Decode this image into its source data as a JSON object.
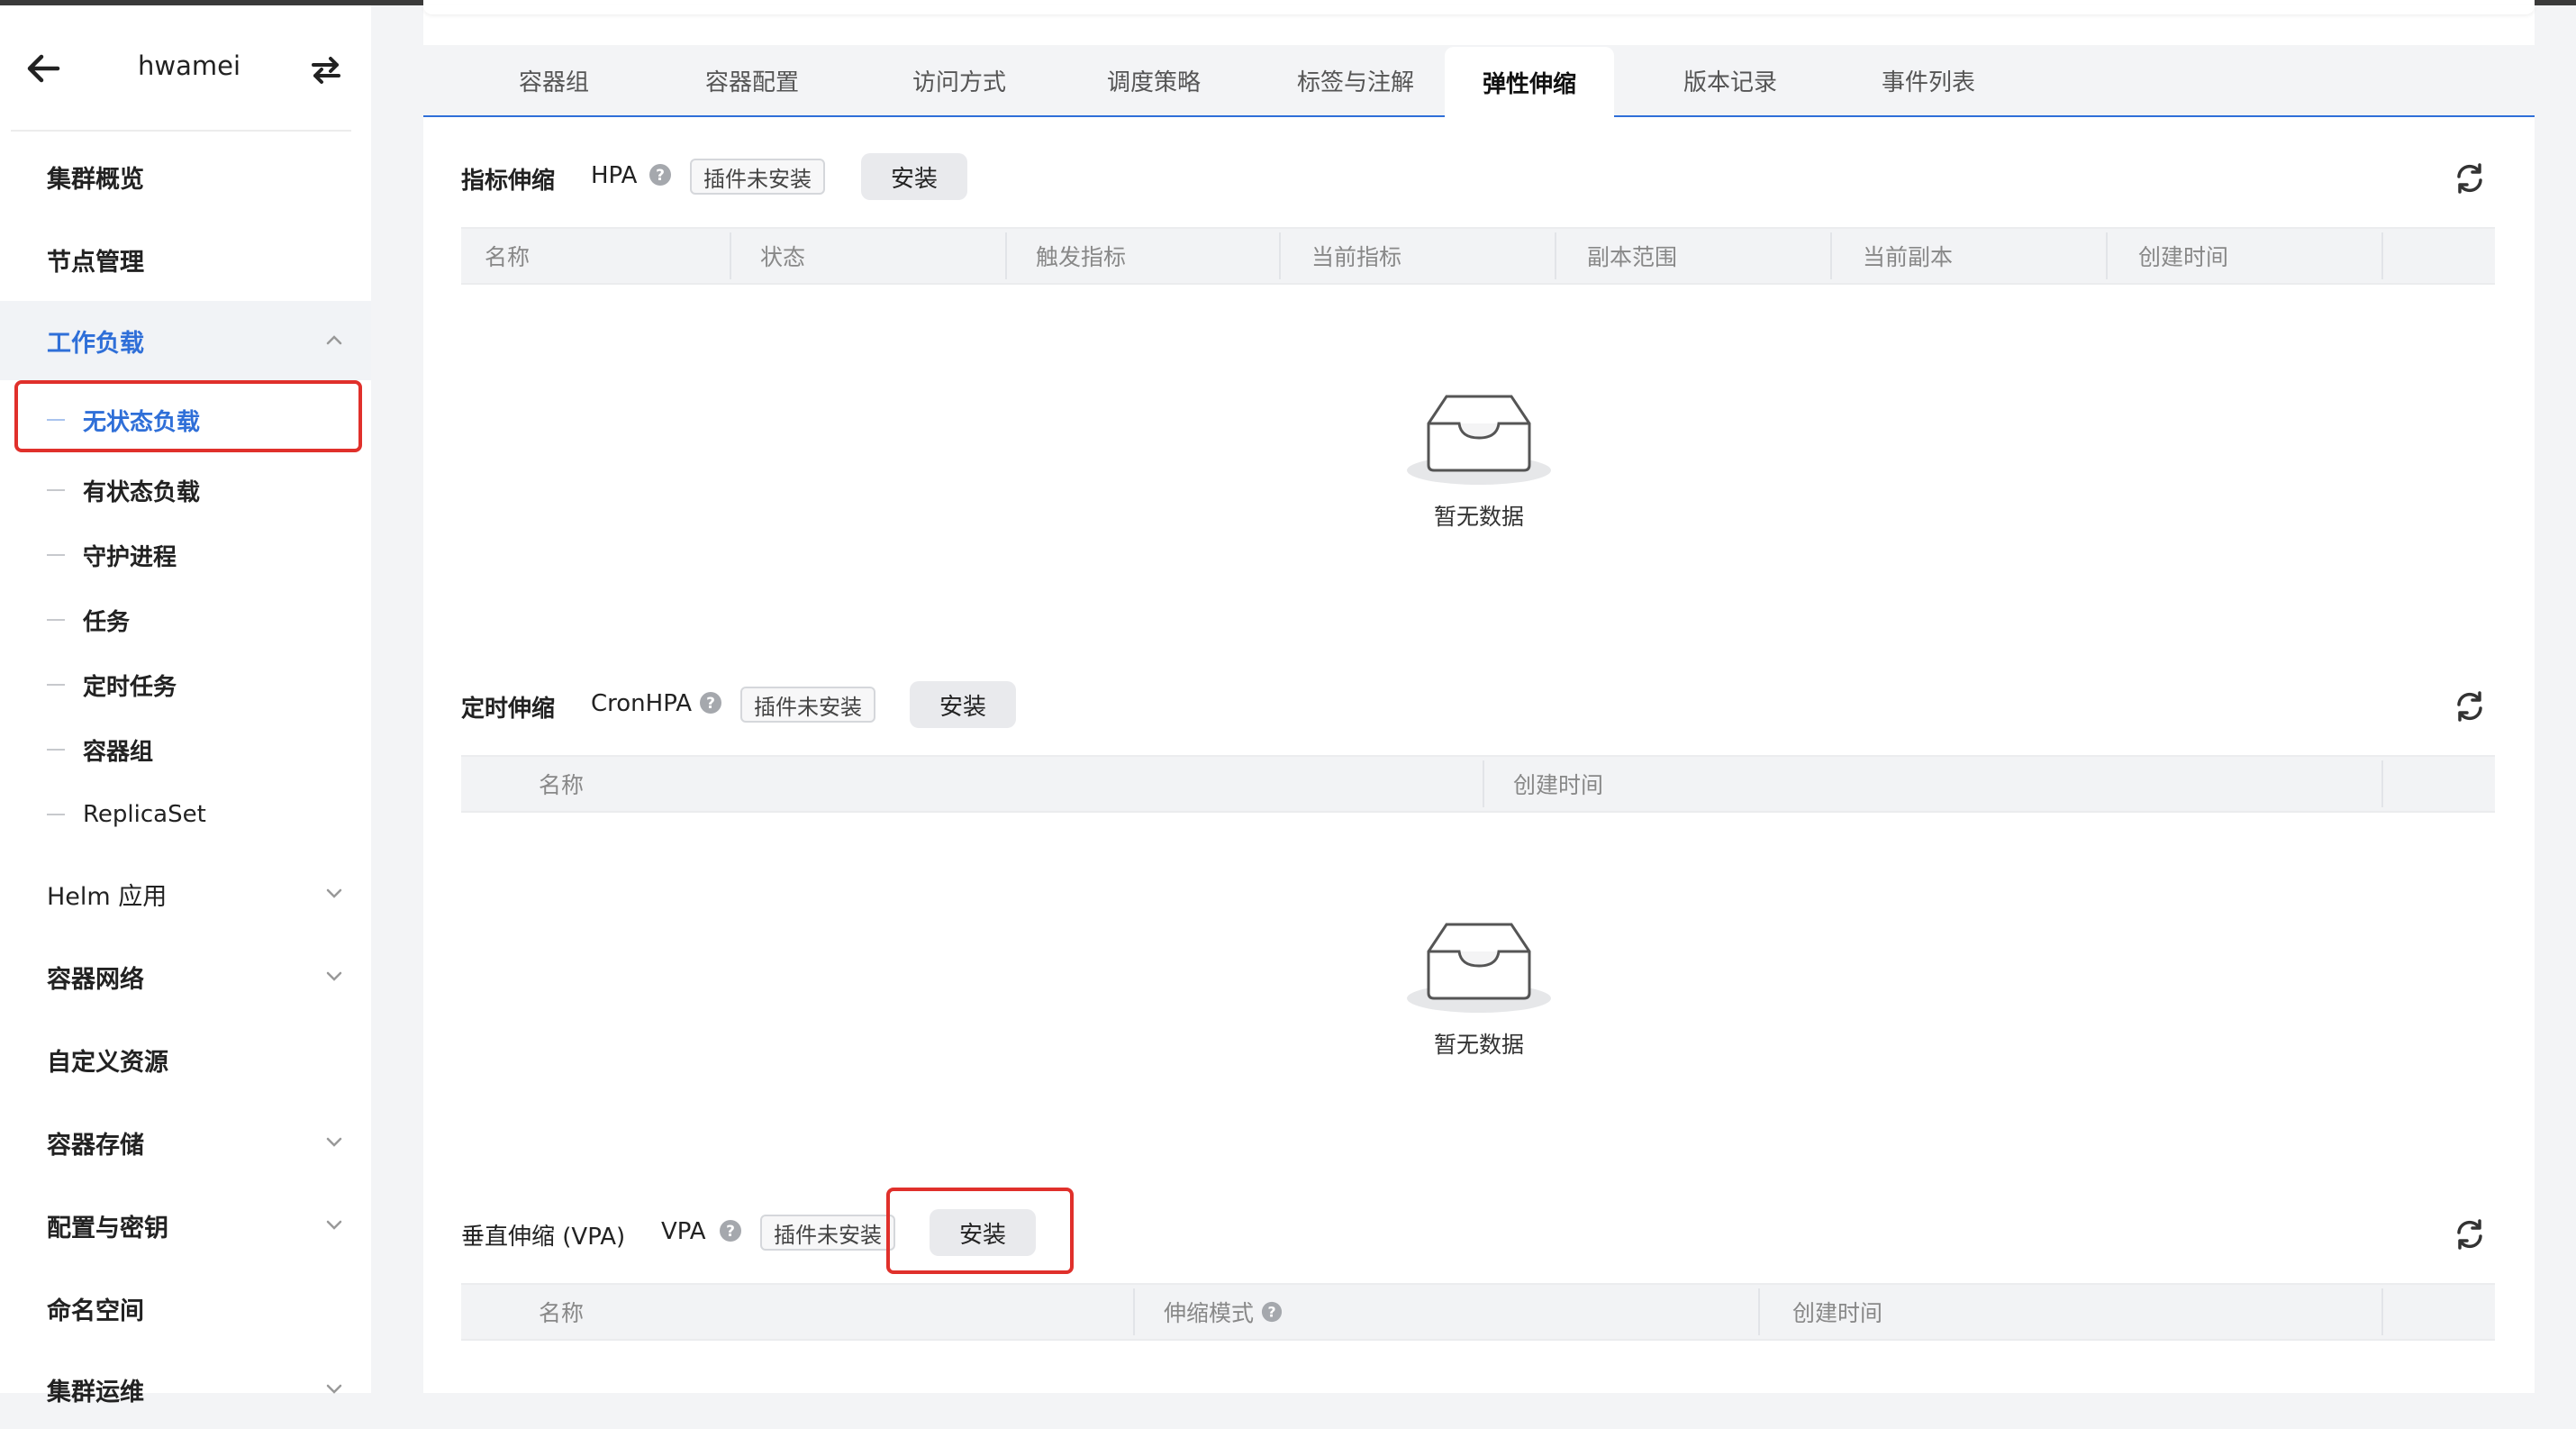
{
  "sidebar": {
    "title": "hwamei",
    "items": [
      {
        "label": "集群概览"
      },
      {
        "label": "节点管理"
      },
      {
        "label": "工作负载"
      },
      {
        "label": "Helm 应用"
      },
      {
        "label": "容器网络"
      },
      {
        "label": "自定义资源"
      },
      {
        "label": "容器存储"
      },
      {
        "label": "配置与密钥"
      },
      {
        "label": "命名空间"
      },
      {
        "label": "集群运维"
      }
    ],
    "workload_children": [
      {
        "label": "无状态负载"
      },
      {
        "label": "有状态负载"
      },
      {
        "label": "守护进程"
      },
      {
        "label": "任务"
      },
      {
        "label": "定时任务"
      },
      {
        "label": "容器组"
      },
      {
        "label": "ReplicaSet"
      }
    ]
  },
  "tabs": [
    {
      "label": "容器组"
    },
    {
      "label": "容器配置"
    },
    {
      "label": "访问方式"
    },
    {
      "label": "调度策略"
    },
    {
      "label": "标签与注解"
    },
    {
      "label": "弹性伸缩"
    },
    {
      "label": "版本记录"
    },
    {
      "label": "事件列表"
    }
  ],
  "active_tab": "弹性伸缩",
  "sections": {
    "hpa": {
      "title": "指标伸缩",
      "kind": "HPA",
      "badge": "插件未安装",
      "install": "安装",
      "columns": [
        "名称",
        "状态",
        "触发指标",
        "当前指标",
        "副本范围",
        "当前副本",
        "创建时间"
      ],
      "empty_text": "暂无数据"
    },
    "cron": {
      "title": "定时伸缩",
      "kind": "CronHPA",
      "badge": "插件未安装",
      "install": "安装",
      "columns": [
        "名称",
        "创建时间"
      ],
      "empty_text": "暂无数据"
    },
    "vpa": {
      "title": "垂直伸缩 (VPA)",
      "kind": "VPA",
      "badge": "插件未安装",
      "install": "安装",
      "columns": [
        "名称",
        "伸缩模式",
        "创建时间"
      ]
    }
  },
  "colors": {
    "accent": "#2f6fd8",
    "highlight_box": "#e0302b"
  }
}
